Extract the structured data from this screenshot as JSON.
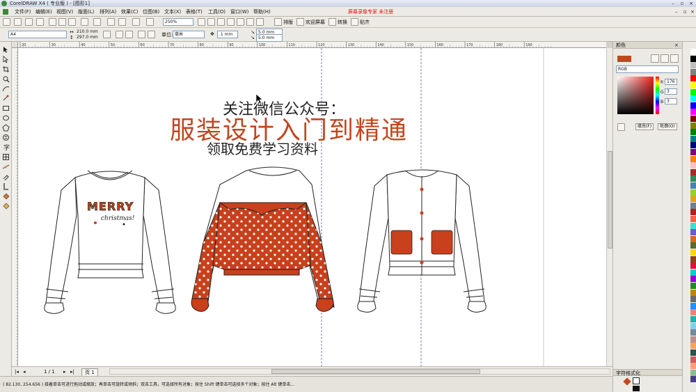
{
  "window": {
    "title": "CorelDRAW X4 ( 专业版 ) - [图形1]",
    "recording_text": "屏幕录像专家 未注册"
  },
  "menu": [
    "文件(F)",
    "编辑(E)",
    "视图(V)",
    "版面(L)",
    "排列(A)",
    "效果(C)",
    "位图(B)",
    "文本(X)",
    "表格(T)",
    "工具(O)",
    "窗口(W)",
    "帮助(H)"
  ],
  "toolbar": {
    "zoom": "250%",
    "paste_label": "贴齐",
    "snap_label": "排版",
    "launcher_label": "欢迎屏幕",
    "convert_label": "转换"
  },
  "property_bar": {
    "page_size": "A4",
    "width": "210.0 mm",
    "height": "297.0 mm",
    "units_label": "单位:",
    "units_value": "毫米",
    "nudge": ".1 mm",
    "dup_x": "5.0 mm",
    "dup_y": "5.0 mm"
  },
  "rulers": {
    "h_ticks": [
      "20",
      "30",
      "40",
      "50",
      "60",
      "70",
      "80",
      "90",
      "100",
      "110",
      "120",
      "130",
      "140",
      "150",
      "160",
      "170",
      "180",
      "190"
    ]
  },
  "artwork": {
    "line1": "关注微信公众号：",
    "line2": "服装设计入门到精通",
    "line3": "领取免费学习资料",
    "merry": "MERRY",
    "christmas": "christmas!"
  },
  "page_nav": {
    "counter": "1 / 1",
    "tab": "页 1"
  },
  "status": {
    "coords": "( 82.130, 254.656 )",
    "hint": "接着单击可进行拖动或缩放；再单击可旋转或倾斜；双击工具，可选择所有对象；按住 Shift 键单击可选择多个对象；按住 Alt 键单击..."
  },
  "color_docker": {
    "title": "颜色",
    "model": "RGB",
    "r_label": "R",
    "r_value": "176",
    "g_label": "G",
    "g_value": "3",
    "b_label": "B",
    "b_value": "3",
    "fill_button": "填充(F)",
    "outline_button": "轮廓(O)",
    "accent": "#c2461f",
    "char_format_title": "字符格式化"
  },
  "colors": {
    "garment_red": "#c8401c",
    "headline_red": "#c2461f"
  }
}
